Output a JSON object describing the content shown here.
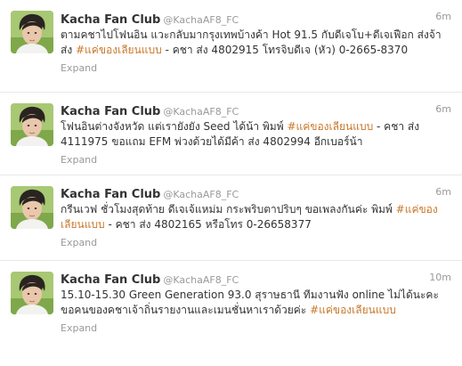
{
  "tweets": [
    {
      "name": "Kacha Fan Club",
      "handle": "@KachaAF8_FC",
      "time": "6m",
      "text_before": "ตามคชาไปโฟนอิน แวะกลับมากรุงเทพบ้างค้า Hot 91.5 กับดีเจโบ+ดีเจเฟือก ส่งจ้าส่ง ",
      "hashtag": "#แค่ของเลียนแบบ",
      "text_after": " - คชา ส่ง 4802915 โทรจิบดีเจ (หัว) 0-2665-8370",
      "expand": "Expand"
    },
    {
      "name": "Kacha Fan Club",
      "handle": "@KachaAF8_FC",
      "time": "6m",
      "text_before": "โฟนอินต่างจังหวัด แต่เรายังยัง Seed ได้น้า พิมพ์ ",
      "hashtag": "#แค่ของเลียนแบบ",
      "text_after": " - คชา ส่ง 4111975 ขอแถม EFM พ่วงด้วยได้มีค้า ส่ง 4802994 อีกเบอร์น้า",
      "expand": "Expand"
    },
    {
      "name": "Kacha Fan Club",
      "handle": "@KachaAF8_FC",
      "time": "6m",
      "text_before": "กรีนเวฟ ชั่วโมงสุดท้าย ดีเจเจ้แหม่ม กระพริบตาปริบๆ ขอเพลงกันค่ะ พิมพ์ ",
      "hashtag": "#แค่ของเลียนแบบ",
      "text_after": " - คชา ส่ง 4802165 หรือโทร 0-26658377",
      "expand": "Expand"
    },
    {
      "name": "Kacha Fan Club",
      "handle": "@KachaAF8_FC",
      "time": "10m",
      "text_before": "15.10-15.30 Green Generation 93.0 สุราษธานี ทีมงานฟัง online ไม่ได้นะคะ ขอคนของคชาเจ้าถิ่นรายงานและเมนชั่นหาเราด้วยค่ะ ",
      "hashtag": "#แค่ของเลียนแบบ",
      "text_after": "",
      "expand": "Expand"
    }
  ]
}
